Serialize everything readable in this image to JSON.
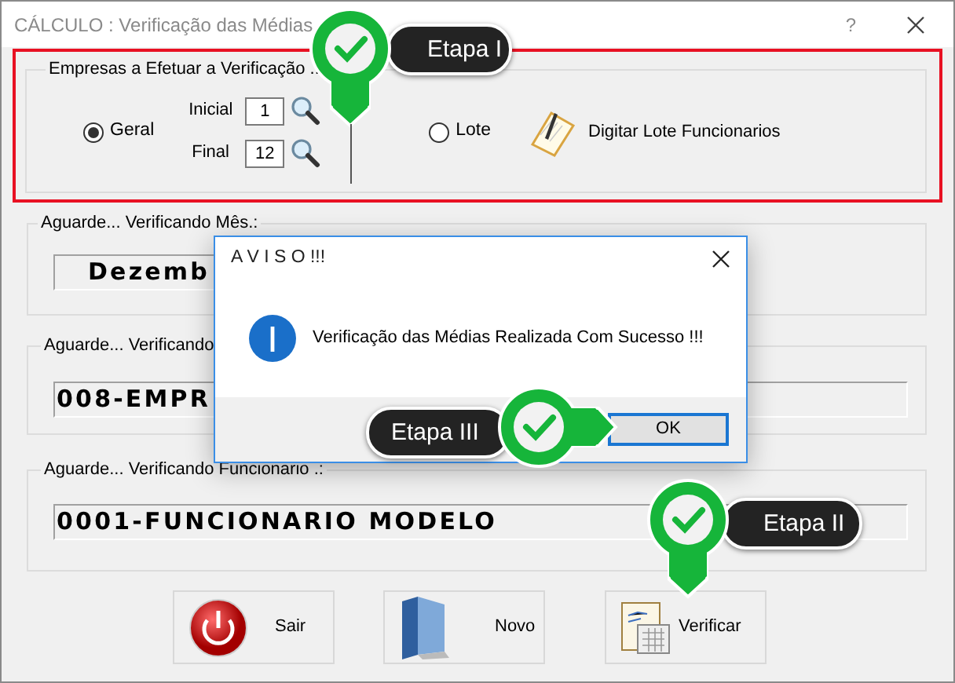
{
  "window": {
    "title": "CÁLCULO : Verificação das Médias",
    "help": "?"
  },
  "companies": {
    "legend": "Empresas a Efetuar a Verificação .:",
    "highlighted": true,
    "options": [
      {
        "label": "Geral",
        "selected": true
      },
      {
        "label": "Lote",
        "selected": false
      }
    ],
    "initial": {
      "label": "Inicial",
      "value": "1"
    },
    "final": {
      "label": "Final",
      "value": "12"
    },
    "lot_link": "Digitar Lote Funcionarios"
  },
  "progress": [
    {
      "legend": "Aguarde... Verificando Mês.:",
      "value": "Dezemb"
    },
    {
      "legend": "Aguarde... Verificando",
      "value": "008-EMPR"
    },
    {
      "legend": "Aguarde... Verificando Funcionario .:",
      "value": "0001-FUNCIONARIO MODELO"
    }
  ],
  "buttons": [
    {
      "label": "Sair",
      "kind": "exit"
    },
    {
      "label": "Novo",
      "kind": "new"
    },
    {
      "label": "Verificar",
      "kind": "verify"
    }
  ],
  "dialog": {
    "title": "A V I S O !!!",
    "message": "Verificação das Médias Realizada Com Sucesso !!!",
    "button": "OK"
  },
  "callouts": [
    {
      "label": "Etapa I",
      "kind": "down",
      "leader": true
    },
    {
      "label": "Etapa II",
      "kind": "down",
      "leader": false
    },
    {
      "label": "Etapa III",
      "kind": "right",
      "leader": false
    }
  ]
}
